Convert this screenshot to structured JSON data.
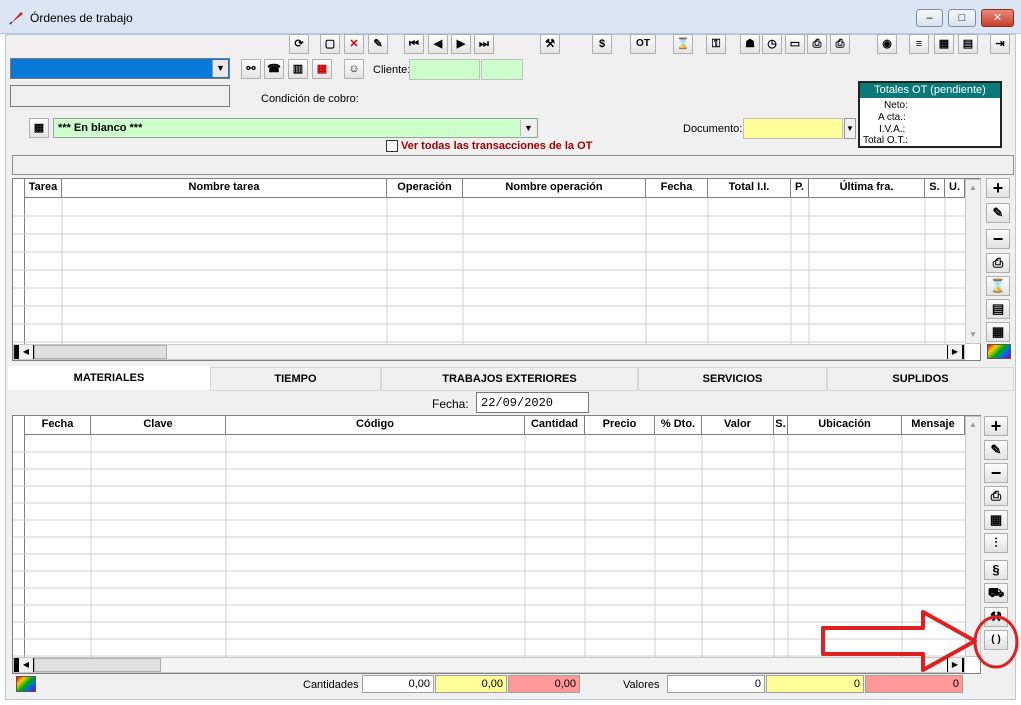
{
  "window": {
    "title": "Órdenes de trabajo",
    "min": "–",
    "max": "□",
    "close": "✕"
  },
  "toolbar": {
    "ot_label": "OT"
  },
  "top": {
    "cliente_label": "Cliente:",
    "condicion_label": "Condición de cobro:",
    "documento_label": "Documento:",
    "blank_combo": "*** En blanco ***",
    "ver_todas": "Ver todas las transacciones de la OT"
  },
  "totales": {
    "title": "Totales OT (pendiente)",
    "neto": "Neto:",
    "acta": "A cta.:",
    "iva": "I.V.A.:",
    "total": "Total O.T.:"
  },
  "grid1": {
    "headers": [
      "Tarea",
      "Nombre tarea",
      "Operación",
      "Nombre operación",
      "Fecha",
      "Total I.I.",
      "P.",
      "Última fra.",
      "S.",
      "U."
    ]
  },
  "tabs": [
    "MATERIALES",
    "TIEMPO",
    "TRABAJOS EXTERIORES",
    "SERVICIOS",
    "SUPLIDOS"
  ],
  "fecha": {
    "label": "Fecha:",
    "value": "22/09/2020"
  },
  "grid2": {
    "headers": [
      "Fecha",
      "Clave",
      "Código",
      "Cantidad",
      "Precio",
      "% Dto.",
      "Valor",
      "S.",
      "Ubicación",
      "Mensaje"
    ]
  },
  "footer": {
    "cantidades_label": "Cantidades",
    "c1": "0,00",
    "c2": "0,00",
    "c3": "0,00",
    "valores_label": "Valores",
    "v1": "0",
    "v2": "0",
    "v3": "0"
  },
  "sidebtn": {
    "add": "+",
    "remove": "−",
    "paren": "( )"
  },
  "colors": {
    "accent_blue": "#0a78d6",
    "green_field": "#ccffcc",
    "yellow_field": "#ffff99",
    "pink_field": "#ff9999",
    "totales_header": "#0a7a78",
    "annotation": "#e02020"
  }
}
